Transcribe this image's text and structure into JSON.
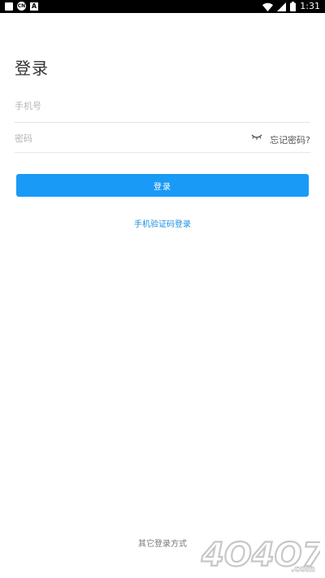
{
  "status_bar": {
    "time": "1:31",
    "left_icons": [
      "square-icon",
      "cn-icon",
      "a-icon"
    ],
    "right_icons": [
      "wifi-icon",
      "signal-icon",
      "battery-icon"
    ]
  },
  "login": {
    "title": "登录",
    "phone_placeholder": "手机号",
    "password_placeholder": "密码",
    "password_toggle_icon": "eye-closed-icon",
    "forgot_password": "忘记密码?",
    "login_button": "登录",
    "sms_login": "手机验证码登录",
    "other_login": "其它登录方式",
    "accent_color": "#1a9af7"
  },
  "watermark": {
    "text": "4O4O7",
    "suffix": ".com"
  }
}
